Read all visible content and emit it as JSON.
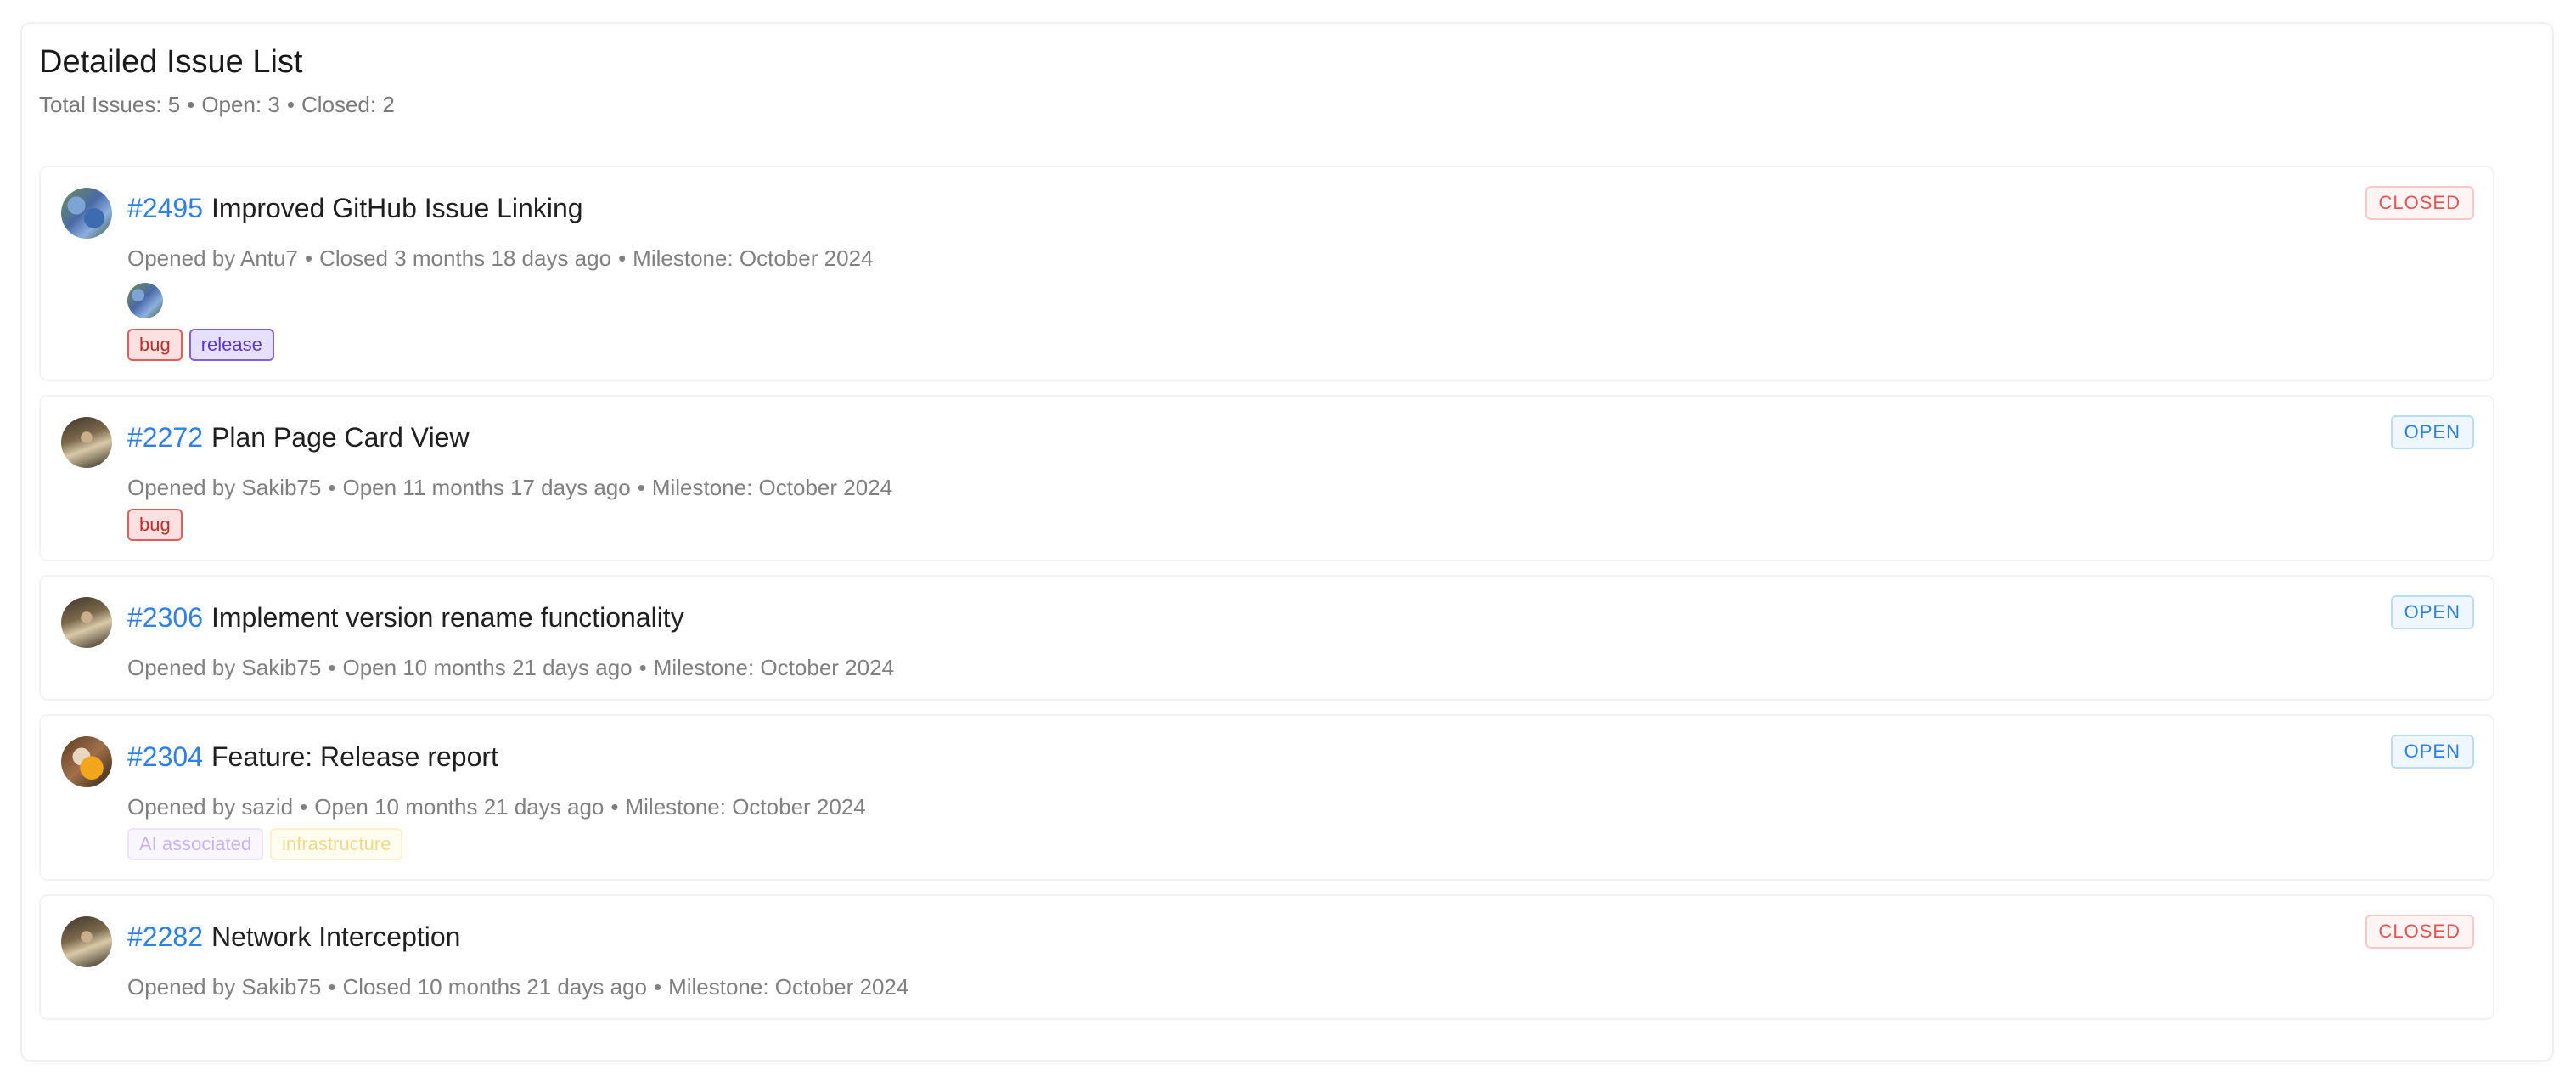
{
  "header": {
    "title": "Detailed Issue List",
    "summary_total": "Total Issues: 5",
    "summary_open": "Open: 3",
    "summary_closed": "Closed: 2",
    "separator": "•"
  },
  "issues": [
    {
      "number": "#2495",
      "title": "Improved GitHub Issue Linking",
      "opened_by": "Opened by Antu7",
      "state_text": "Closed 3 months 18 days ago",
      "milestone": "Milestone: October 2024",
      "status": "CLOSED",
      "labels": [
        "bug",
        "release"
      ]
    },
    {
      "number": "#2272",
      "title": "Plan Page Card View",
      "opened_by": "Opened by Sakib75",
      "state_text": "Open 11 months 17 days ago",
      "milestone": "Milestone: October 2024",
      "status": "OPEN",
      "labels": [
        "bug"
      ]
    },
    {
      "number": "#2306",
      "title": "Implement version rename functionality",
      "opened_by": "Opened by Sakib75",
      "state_text": "Open 10 months 21 days ago",
      "milestone": "Milestone: October 2024",
      "status": "OPEN",
      "labels": []
    },
    {
      "number": "#2304",
      "title": "Feature: Release report",
      "opened_by": "Opened by sazid",
      "state_text": "Open 10 months 21 days ago",
      "milestone": "Milestone: October 2024",
      "status": "OPEN",
      "labels": [
        "AI associated",
        "infrastructure"
      ]
    },
    {
      "number": "#2282",
      "title": "Network Interception",
      "opened_by": "Opened by Sakib75",
      "state_text": "Closed 10 months 21 days ago",
      "milestone": "Milestone: October 2024",
      "status": "CLOSED",
      "labels": []
    }
  ],
  "colors": {
    "link": "#2f80e4",
    "closed": "#e45454",
    "open": "#2f80e4",
    "bug": "#e45b5b",
    "release": "#7f60e8"
  },
  "icons": {
    "avatar": "user-avatar",
    "assignee": "assignee-avatar"
  }
}
